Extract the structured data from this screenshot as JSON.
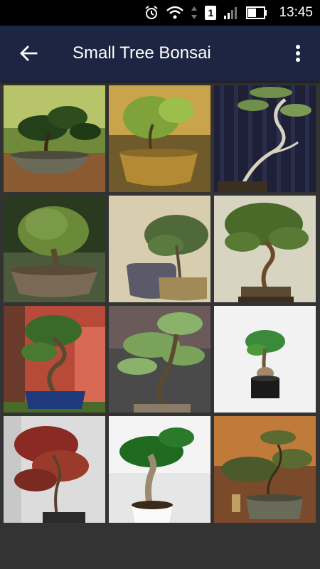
{
  "status_bar": {
    "time": "13:45",
    "sim_badge": "1",
    "icons": [
      "alarm-icon",
      "wifi-icon",
      "data-arrows-icon",
      "sim-icon",
      "signal-icon",
      "battery-icon"
    ]
  },
  "app_bar": {
    "title": "Small Tree Bonsai",
    "back_icon": "arrow-left-icon",
    "menu_icon": "more-vertical-icon",
    "background": "#1c2541"
  },
  "gallery": {
    "tile_count": 12,
    "tiles": [
      {
        "name": "bonsai-image-1",
        "kind": "bonsai-photo"
      },
      {
        "name": "bonsai-image-2",
        "kind": "bonsai-photo"
      },
      {
        "name": "bonsai-image-3",
        "kind": "bonsai-photo"
      },
      {
        "name": "bonsai-image-4",
        "kind": "bonsai-photo"
      },
      {
        "name": "bonsai-image-5",
        "kind": "bonsai-photo"
      },
      {
        "name": "bonsai-image-6",
        "kind": "bonsai-photo"
      },
      {
        "name": "bonsai-image-7",
        "kind": "bonsai-photo"
      },
      {
        "name": "bonsai-image-8",
        "kind": "bonsai-photo"
      },
      {
        "name": "bonsai-image-9",
        "kind": "bonsai-photo"
      },
      {
        "name": "bonsai-image-10",
        "kind": "bonsai-photo"
      },
      {
        "name": "bonsai-image-11",
        "kind": "bonsai-photo"
      },
      {
        "name": "bonsai-image-12",
        "kind": "bonsai-photo"
      }
    ]
  }
}
